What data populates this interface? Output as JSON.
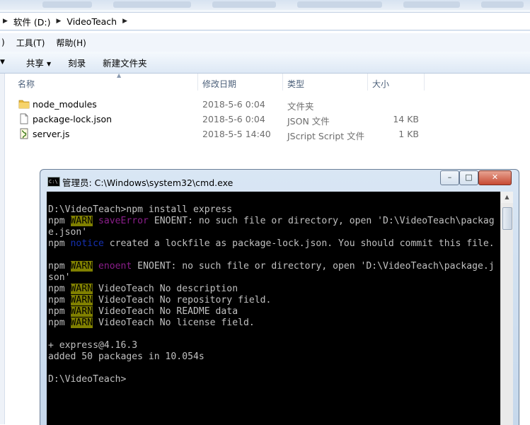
{
  "explorer": {
    "breadcrumb": [
      "软件 (D:)",
      "VideoTeach"
    ],
    "menu": [
      "工具(T)",
      "帮助(H)"
    ],
    "toolbar": [
      "共享",
      "刻录",
      "新建文件夹"
    ],
    "columns": [
      "名称",
      "修改日期",
      "类型",
      "大小"
    ],
    "files": [
      {
        "name": "node_modules",
        "date": "2018-5-6 0:04",
        "type": "文件夹",
        "size": "",
        "icon": "folder-icon"
      },
      {
        "name": "package-lock.json",
        "date": "2018-5-6 0:04",
        "type": "JSON 文件",
        "size": "14 KB",
        "icon": "file-icon"
      },
      {
        "name": "server.js",
        "date": "2018-5-5 14:40",
        "type": "JScript Script 文件",
        "size": "1 KB",
        "icon": "script-icon"
      }
    ]
  },
  "cmd": {
    "title": "管理员: C:\\Windows\\system32\\cmd.exe",
    "icon_label": "C:\\",
    "buttons": [
      "–",
      "□",
      "✕"
    ],
    "lines": [
      "D:\\VideoTeach>npm install express",
      "npm WARN saveError ENOENT: no such file or directory, open 'D:\\VideoTeach\\packag",
      "e.json'",
      "npm notice created a lockfile as package-lock.json. You should commit this file.",
      "",
      "npm WARN enoent ENOENT: no such file or directory, open 'D:\\VideoTeach\\package.j",
      "son'",
      "npm WARN VideoTeach No description",
      "npm WARN VideoTeach No repository field.",
      "npm WARN VideoTeach No README data",
      "npm WARN VideoTeach No license field.",
      "",
      "+ express@4.16.3",
      "added 50 packages in 10.054s",
      "",
      "D:\\VideoTeach>"
    ],
    "colors": {
      "warn_bg": "#808000",
      "error_keyword": "#8b1e8b",
      "notice_keyword": "#1530b0",
      "text": "#c0c0c0",
      "background": "#000000"
    }
  }
}
